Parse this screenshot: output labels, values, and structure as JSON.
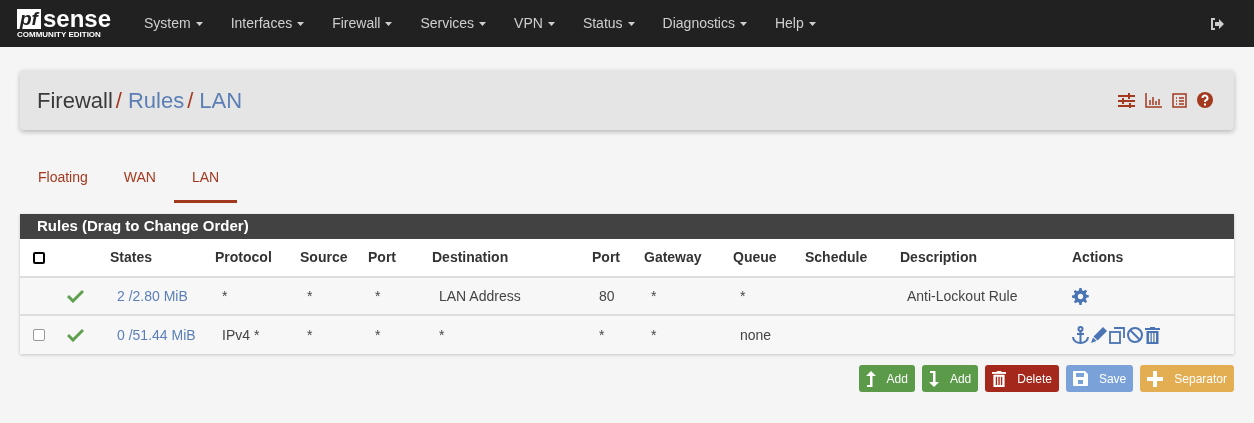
{
  "brand": {
    "mark": "pf",
    "name": "sense",
    "edition": "COMMUNITY EDITION"
  },
  "nav": [
    {
      "label": "System"
    },
    {
      "label": "Interfaces"
    },
    {
      "label": "Firewall"
    },
    {
      "label": "Services"
    },
    {
      "label": "VPN"
    },
    {
      "label": "Status"
    },
    {
      "label": "Diagnostics"
    },
    {
      "label": "Help"
    }
  ],
  "breadcrumb": [
    {
      "label": "Firewall",
      "link": false,
      "separator": "/"
    },
    {
      "label": "Rules",
      "link": true,
      "separator": "/"
    },
    {
      "label": "LAN",
      "link": true
    }
  ],
  "tabs": [
    {
      "label": "Floating",
      "selected": false
    },
    {
      "label": "WAN",
      "selected": false
    },
    {
      "label": "LAN",
      "selected": true
    }
  ],
  "table": {
    "title": "Rules (Drag to Change Order)",
    "select_all": {
      "checked": false
    },
    "columns": [
      "States",
      "Protocol",
      "Source",
      "Port",
      "Destination",
      "Port",
      "Gateway",
      "Queue",
      "Schedule",
      "Description",
      "Actions"
    ],
    "rows": [
      {
        "enabled": true,
        "states": "2 /2.80 MiB",
        "protocol": "*",
        "source": "*",
        "source_port": "*",
        "destination": "LAN Address",
        "destination_port": "80",
        "gateway": "*",
        "queue": "*",
        "description": "Anti-Lockout Rule",
        "actions": [
          {
            "kind": "settings"
          }
        ]
      },
      {
        "checked": false,
        "enabled": true,
        "states": "0 /51.44 MiB",
        "protocol": "IPv4 *",
        "source": "*",
        "source_port": "*",
        "destination": "*",
        "destination_port": "*",
        "gateway": "*",
        "queue": "none",
        "actions": [
          {
            "kind": "anchor"
          },
          {
            "kind": "edit"
          },
          {
            "kind": "copy"
          },
          {
            "kind": "disable"
          },
          {
            "kind": "delete"
          }
        ]
      }
    ]
  },
  "buttons": [
    {
      "kind": "add_top",
      "label": "Add"
    },
    {
      "kind": "add_bottom",
      "label": "Add"
    },
    {
      "kind": "delete",
      "label": "Delete"
    },
    {
      "kind": "save",
      "label": "Save"
    },
    {
      "kind": "separator",
      "label": "Separator"
    }
  ]
}
